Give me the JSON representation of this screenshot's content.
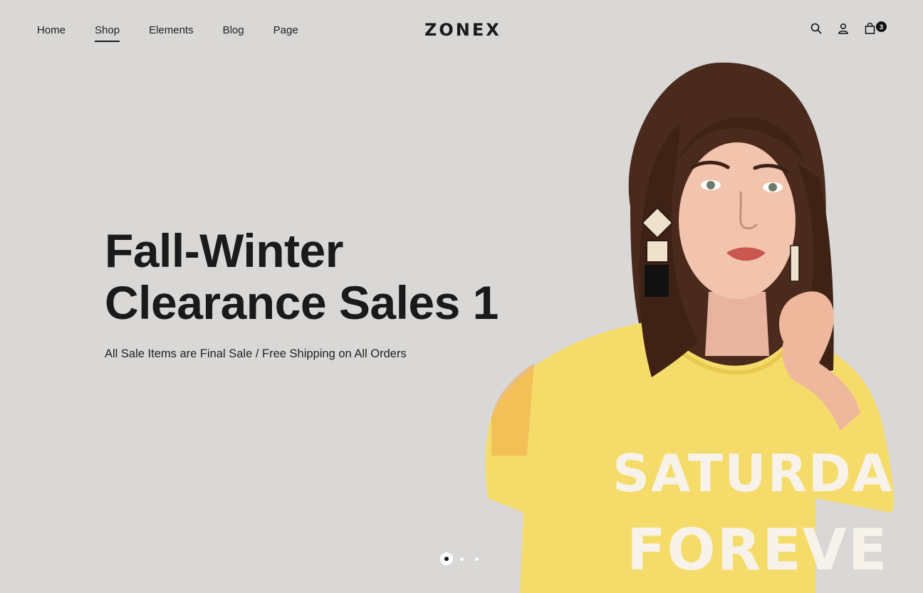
{
  "nav": {
    "items": [
      {
        "label": "Home"
      },
      {
        "label": "Shop"
      },
      {
        "label": "Elements"
      },
      {
        "label": "Blog"
      },
      {
        "label": "Page"
      }
    ],
    "active": "Shop"
  },
  "logo": "ZONEX",
  "header_icons": {
    "search": "search-icon",
    "account": "user-icon",
    "cart": "shopping-bag-icon",
    "cart_count": "3"
  },
  "hero": {
    "title_line1": "Fall-Winter",
    "title_line2": "Clearance Sales 1",
    "subtitle": "All Sale Items are Final Sale / Free Shipping on All Orders",
    "shirt_text_line1": "SATURDA",
    "shirt_text_line2": "FOREVE"
  },
  "slider": {
    "slides": 3,
    "active_index": 0
  },
  "colors": {
    "background": "#d9d8d6",
    "text": "#1a1a1a",
    "shirt": "#f5dc6a"
  }
}
